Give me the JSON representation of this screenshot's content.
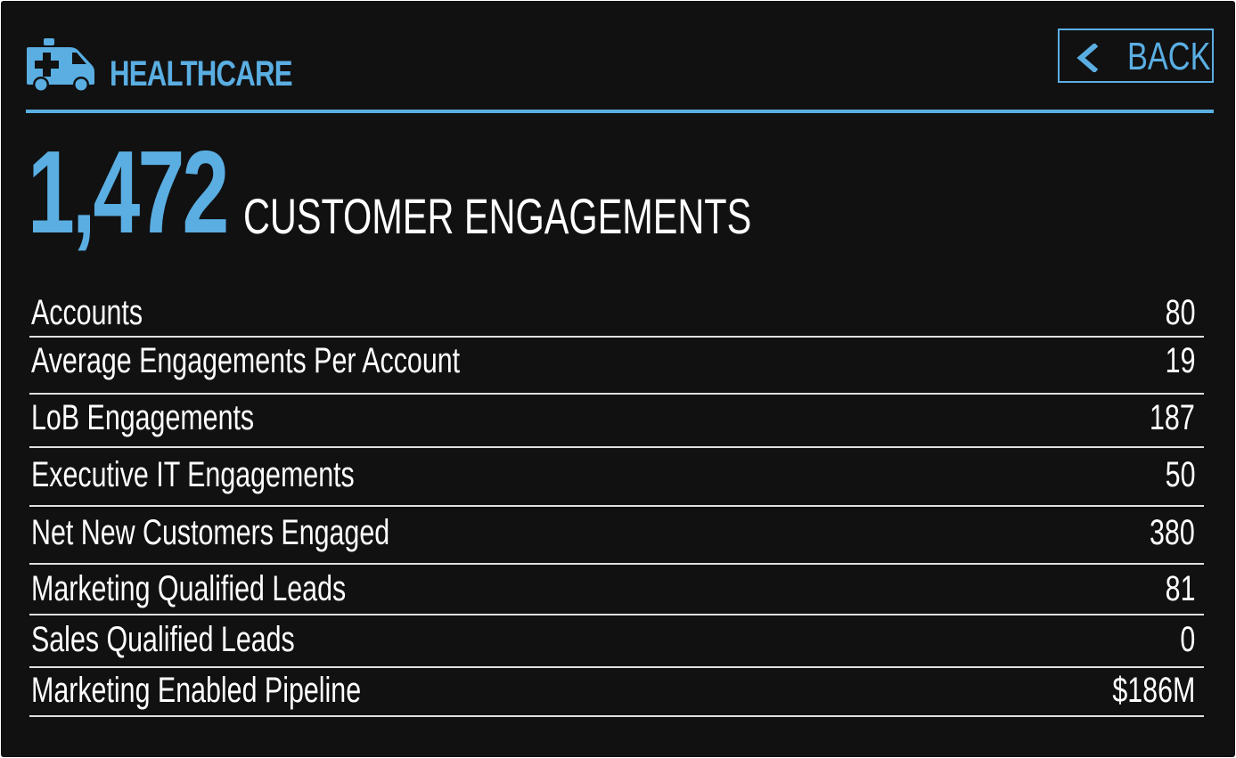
{
  "header": {
    "category_title": "HEALTHCARE",
    "category_icon": "ambulance-icon",
    "back_label": "BACK",
    "back_icon": "chevron-left-icon"
  },
  "summary": {
    "total_value": "1,472",
    "total_label": "CUSTOMER ENGAGEMENTS"
  },
  "stats": [
    {
      "label": "Accounts",
      "value": "80"
    },
    {
      "label": "Average Engagements Per Account",
      "value": "19"
    },
    {
      "label": "LoB Engagements",
      "value": "187"
    },
    {
      "label": "Executive IT Engagements",
      "value": "50"
    },
    {
      "label": "Net New Customers Engaged",
      "value": "380"
    },
    {
      "label": "Marketing Qualified Leads",
      "value": "81"
    },
    {
      "label": "Sales Qualified Leads",
      "value": "0"
    },
    {
      "label": "Marketing Enabled Pipeline",
      "value": "$186M"
    }
  ],
  "colors": {
    "accent": "#5aaee2",
    "background": "#111112",
    "text": "#ffffff",
    "divider": "#e0e0e0"
  }
}
